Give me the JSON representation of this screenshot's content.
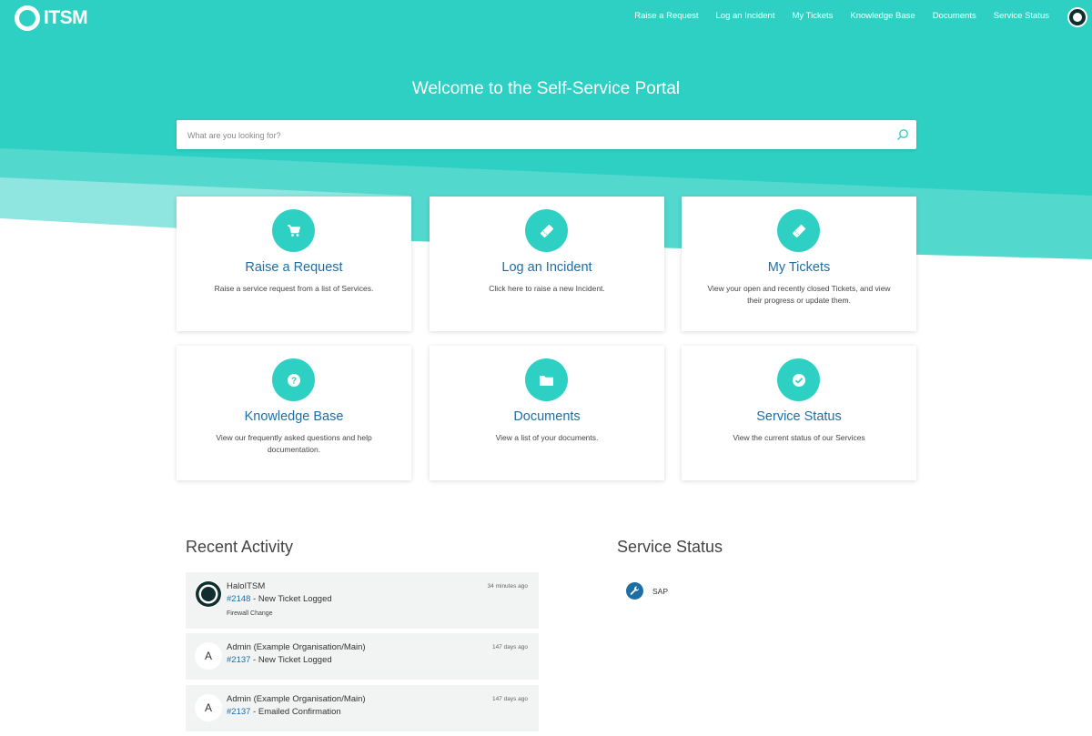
{
  "brand": {
    "name": "ITSM"
  },
  "nav": [
    {
      "label": "Raise a Request"
    },
    {
      "label": "Log an Incident"
    },
    {
      "label": "My Tickets"
    },
    {
      "label": "Knowledge Base"
    },
    {
      "label": "Documents"
    },
    {
      "label": "Service Status"
    }
  ],
  "hero": {
    "title": "Welcome to the Self-Service Portal",
    "search_placeholder": "What are you looking for?"
  },
  "cards": [
    {
      "title": "Raise a Request",
      "desc": "Raise a service request from a list of Services.",
      "icon": "cart-icon"
    },
    {
      "title": "Log an Incident",
      "desc": "Click here to raise a new Incident.",
      "icon": "ticket-icon"
    },
    {
      "title": "My Tickets",
      "desc": "View your open and recently closed Tickets, and view their progress or update them.",
      "icon": "ticket-icon"
    },
    {
      "title": "Knowledge Base",
      "desc": "View our frequently asked questions and help documentation.",
      "icon": "question-icon"
    },
    {
      "title": "Documents",
      "desc": "View a list of your documents.",
      "icon": "folder-icon"
    },
    {
      "title": "Service Status",
      "desc": "View the current status of our Services",
      "icon": "check-icon"
    }
  ],
  "recent_activity": {
    "title": "Recent Activity",
    "items": [
      {
        "who": "HaloITSM",
        "time": "34 minutes ago",
        "ticket": "#2148",
        "action": " - New Ticket Logged",
        "note": "Firewall Change",
        "avatar": ""
      },
      {
        "who": "Admin (Example Organisation/Main)",
        "time": "147 days ago",
        "ticket": "#2137",
        "action": " - New Ticket Logged",
        "note": "",
        "avatar": "A"
      },
      {
        "who": "Admin (Example Organisation/Main)",
        "time": "147 days ago",
        "ticket": "#2137",
        "action": " - Emailed Confirmation",
        "note": "",
        "avatar": "A"
      }
    ]
  },
  "service_status": {
    "title": "Service Status",
    "items": [
      {
        "label": "SAP",
        "icon": "wrench-icon"
      }
    ]
  },
  "colors": {
    "accent": "#2ed0c4",
    "link": "#1e6ea6",
    "dark": "#0f2f2f"
  }
}
